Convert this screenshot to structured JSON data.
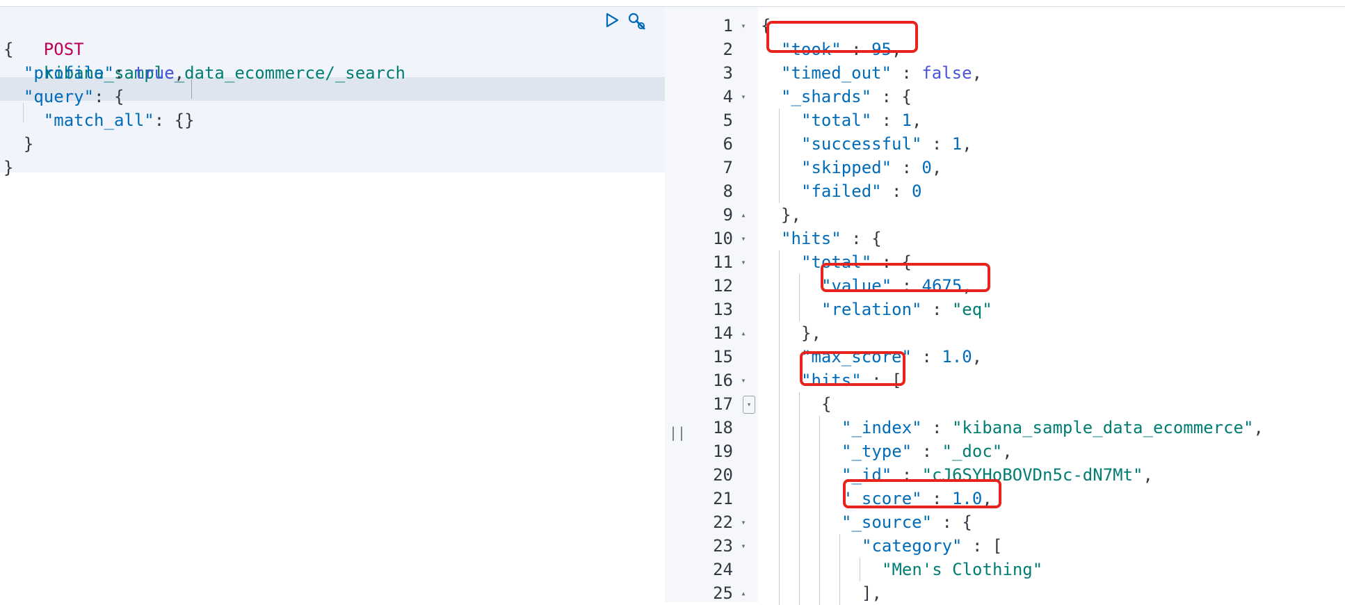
{
  "request": {
    "method": "POST",
    "path": "kibana_sample_data_ecommerce/_search",
    "lines": [
      "{",
      "  \"profile\": true,",
      "  \"query\": {",
      "    \"match_all\": {}",
      "  }",
      "}"
    ],
    "actions": [
      "play-icon",
      "wrench-icon"
    ]
  },
  "divider_glyph": "||",
  "response": {
    "lines": [
      {
        "n": "1",
        "fold": "▾",
        "indent": 0,
        "text": "{"
      },
      {
        "n": "2",
        "fold": "",
        "indent": 1,
        "text": "\"took\" : 95,"
      },
      {
        "n": "3",
        "fold": "",
        "indent": 1,
        "text": "\"timed_out\" : false,"
      },
      {
        "n": "4",
        "fold": "▾",
        "indent": 1,
        "text": "\"_shards\" : {"
      },
      {
        "n": "5",
        "fold": "",
        "indent": 2,
        "text": "\"total\" : 1,"
      },
      {
        "n": "6",
        "fold": "",
        "indent": 2,
        "text": "\"successful\" : 1,"
      },
      {
        "n": "7",
        "fold": "",
        "indent": 2,
        "text": "\"skipped\" : 0,"
      },
      {
        "n": "8",
        "fold": "",
        "indent": 2,
        "text": "\"failed\" : 0"
      },
      {
        "n": "9",
        "fold": "▴",
        "indent": 1,
        "text": "},"
      },
      {
        "n": "10",
        "fold": "▾",
        "indent": 1,
        "text": "\"hits\" : {"
      },
      {
        "n": "11",
        "fold": "▾",
        "indent": 2,
        "text": "\"total\" : {"
      },
      {
        "n": "12",
        "fold": "",
        "indent": 3,
        "text": "\"value\" : 4675,"
      },
      {
        "n": "13",
        "fold": "",
        "indent": 3,
        "text": "\"relation\" : \"eq\""
      },
      {
        "n": "14",
        "fold": "▴",
        "indent": 2,
        "text": "},"
      },
      {
        "n": "15",
        "fold": "",
        "indent": 2,
        "text": "\"max_score\" : 1.0,"
      },
      {
        "n": "16",
        "fold": "▾",
        "indent": 2,
        "text": "\"hits\" : ["
      },
      {
        "n": "17",
        "fold": "▾",
        "indent": 3,
        "text": "{"
      },
      {
        "n": "18",
        "fold": "",
        "indent": 4,
        "text": "\"_index\" : \"kibana_sample_data_ecommerce\","
      },
      {
        "n": "19",
        "fold": "",
        "indent": 4,
        "text": "\"_type\" : \"_doc\","
      },
      {
        "n": "20",
        "fold": "",
        "indent": 4,
        "text": "\"_id\" : \"cJ6SYHoBOVDn5c-dN7Mt\","
      },
      {
        "n": "21",
        "fold": "",
        "indent": 4,
        "text": "\"_score\" : 1.0,"
      },
      {
        "n": "22",
        "fold": "▾",
        "indent": 4,
        "text": "\"_source\" : {"
      },
      {
        "n": "23",
        "fold": "▾",
        "indent": 5,
        "text": "\"category\" : ["
      },
      {
        "n": "24",
        "fold": "",
        "indent": 6,
        "text": "\"Men's Clothing\""
      },
      {
        "n": "25",
        "fold": "▴",
        "indent": 5,
        "text": "],"
      }
    ]
  }
}
